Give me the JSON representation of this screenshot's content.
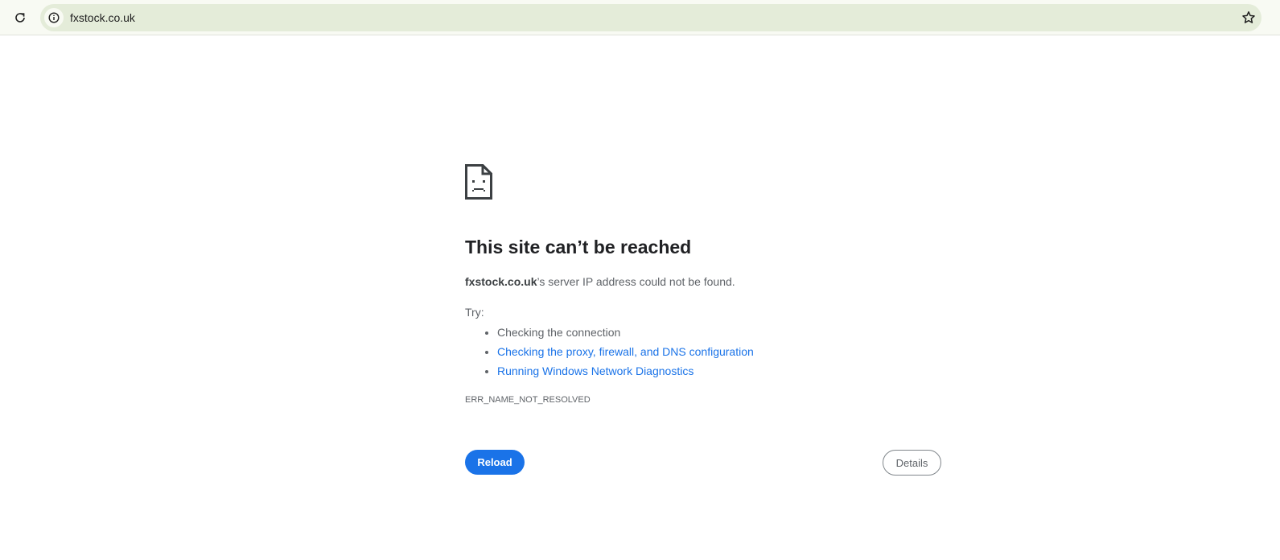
{
  "browser": {
    "url": "fxstock.co.uk",
    "icons": {
      "reload": "reload-icon",
      "site_info": "info-icon",
      "bookmark": "star-icon"
    }
  },
  "error_page": {
    "icon": "sad-document-icon",
    "title": "This site can’t be reached",
    "summary_host": "fxstock.co.uk",
    "summary_rest": "’s server IP address could not be found.",
    "try_label": "Try:",
    "suggestions": [
      "Checking the connection",
      "Checking the proxy, firewall, and DNS configuration",
      "Running Windows Network Diagnostics"
    ],
    "error_code": "ERR_NAME_NOT_RESOLVED",
    "reload_label": "Reload",
    "details_label": "Details"
  },
  "colors": {
    "toolbar_bg": "#f8faf3",
    "omnibox_bg": "#e4ecd9",
    "link": "#1a73e8",
    "primary_button": "#1a73e8"
  }
}
